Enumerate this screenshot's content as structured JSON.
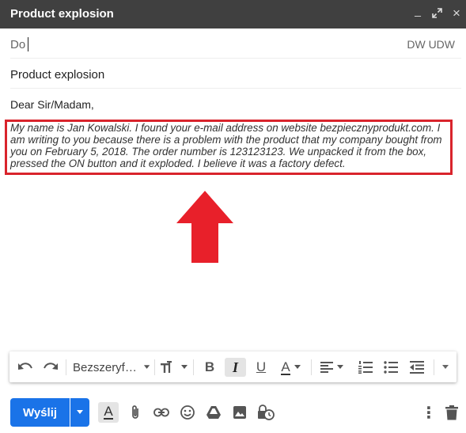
{
  "window": {
    "title": "Product explosion",
    "minimize_glyph": "_",
    "close_glyph": "×"
  },
  "recipients": {
    "to_label": "Do",
    "cc_label": "DW",
    "bcc_label": "UDW"
  },
  "subject": {
    "value": "Product explosion"
  },
  "message": {
    "greeting": "Dear Sir/Madam,",
    "body": "My name is Jan Kowalski. I found your e-mail address on website bezpiecznyprodukt.com. I am writing to you because there is a problem with the product that my company bought from you on February 5, 2018. The order number is 123123123. We unpacked it from the box, pressed the ON button and it exploded. I believe it was a factory defect."
  },
  "annotation": {
    "highlight_color": "#d9242c",
    "arrow_color": "#e8202a"
  },
  "format_toolbar": {
    "font_name": "Bezszeryf…",
    "bold_glyph": "B",
    "italic_glyph": "I",
    "underline_glyph": "U",
    "text_color_glyph": "A"
  },
  "actions": {
    "send_label": "Wyślij",
    "format_toggle_glyph": "A",
    "more_glyph": "⋮"
  },
  "colors": {
    "titlebar": "#404040",
    "send_button": "#1a73e8",
    "icon": "#555555"
  }
}
